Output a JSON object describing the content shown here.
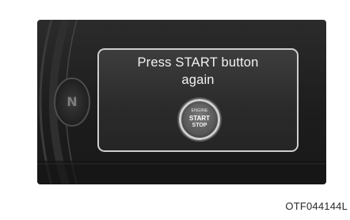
{
  "display": {
    "gear_indicator": "N",
    "message_line1": "Press START button",
    "message_line2": "again"
  },
  "start_button": {
    "line1": "ENGINE",
    "line2": "START",
    "line3": "STOP"
  },
  "figure_code": "OTF044144L",
  "colors": {
    "panel_background": "#1d1d1d",
    "popup_border": "#cfcfcf",
    "text": "#f2f2f2"
  }
}
